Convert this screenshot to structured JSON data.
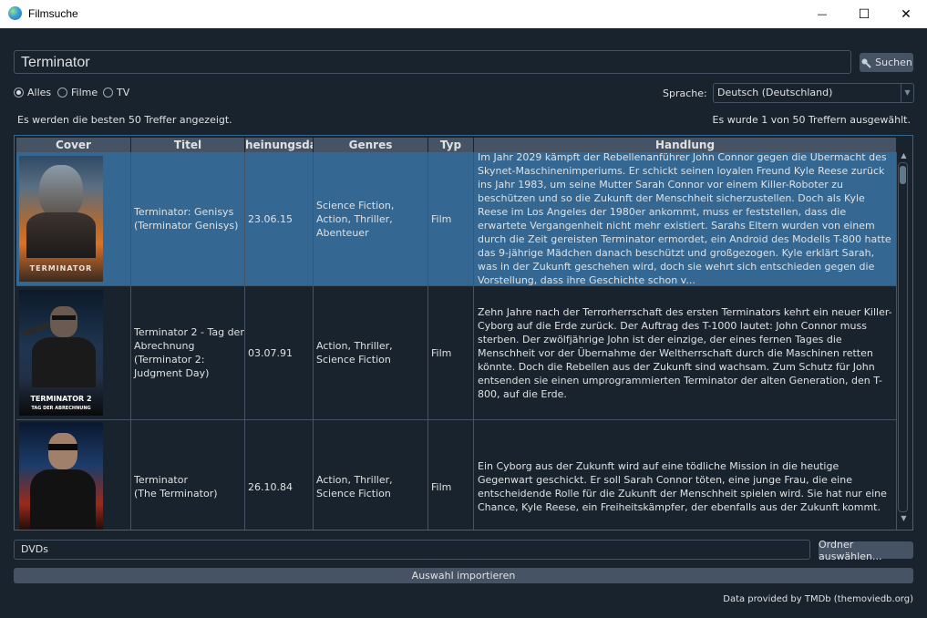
{
  "window": {
    "title": "Filmsuche",
    "minimize": "—",
    "maximize": "☐",
    "close": "✕"
  },
  "search": {
    "query": "Terminator",
    "button_label": "Suchen",
    "icon": "search-icon"
  },
  "filters": {
    "options": [
      "Alles",
      "Filme",
      "TV"
    ],
    "selected": "Alles"
  },
  "language": {
    "label": "Sprache:",
    "value": "Deutsch (Deutschland)"
  },
  "status": {
    "left": "Es werden die besten 50 Treffer angezeigt.",
    "right": "Es wurde 1 von 50 Treffern ausgewählt."
  },
  "table": {
    "columns": [
      "Cover",
      "Titel",
      "Erscheinungsdatum",
      "Genres",
      "Typ",
      "Handlung"
    ],
    "visible_header": "heinungsda",
    "rows": [
      {
        "selected": true,
        "titel": "Terminator: Genisys\n(Terminator Genisys)",
        "datum": "23.06.15",
        "genres": "Science Fiction,\nAction, Thriller,\nAbenteuer",
        "typ": "Film",
        "handlung": "Im Jahr 2029 kämpft der Rebellenanführer John Connor gegen die Übermacht des Skynet-Maschinenimperiums. Er schickt seinen loyalen Freund Kyle Reese zurück ins Jahr 1983, um seine Mutter Sarah Connor vor einem Killer-Roboter zu beschützen und so die Zukunft der Menschheit sicherzustellen. Doch als Kyle Reese im Los Angeles der 1980er ankommt, muss er feststellen, dass die erwartete Vergangenheit nicht mehr existiert. Sarahs Eltern wurden von einem durch die Zeit gereisten Terminator ermordet, ein Android des Modells T-800 hatte das 9-jährige Mädchen danach beschützt und großgezogen. Kyle erklärt Sarah, was in der Zukunft geschehen wird, doch sie wehrt sich entschieden gegen die Vorstellung, dass ihre Geschichte schon v...",
        "poster_text": "TERMINATOR"
      },
      {
        "selected": false,
        "titel": "Terminator 2 - Tag der Abrechnung\n(Terminator 2: Judgment Day)",
        "datum": "03.07.91",
        "genres": "Action, Thriller,\nScience Fiction",
        "typ": "Film",
        "handlung": "Zehn Jahre nach der Terrorherrschaft des ersten Terminators kehrt ein neuer Killer-Cyborg auf die Erde zurück. Der Auftrag des T-1000 lautet: John Connor muss sterben. Der zwölfjährige John ist der einzige, der eines fernen Tages die Menschheit vor der Übernahme der Weltherrschaft durch die Maschinen retten könnte. Doch die Rebellen aus der Zukunft sind wachsam. Zum Schutz für John entsenden sie einen umprogrammierten Terminator der alten Generation, den T-800, auf die Erde.",
        "poster_text": "TERMINATOR 2",
        "poster_subtext": "TAG DER ABRECHNUNG"
      },
      {
        "selected": false,
        "titel": "Terminator\n(The Terminator)",
        "datum": "26.10.84",
        "genres": "Action, Thriller,\nScience Fiction",
        "typ": "Film",
        "handlung": "Ein Cyborg aus der Zukunft wird auf eine tödliche Mission in die heutige Gegenwart geschickt. Er soll Sarah Connor töten, eine junge Frau, die eine entscheidende Rolle für die Zukunft der Menschheit spielen wird. Sie hat nur eine Chance, Kyle Reese, ein Freiheitskämpfer, der ebenfalls aus der Zukunft kommt."
      }
    ]
  },
  "folder": {
    "value": "DVDs",
    "button_label": "Ordner auswählen..."
  },
  "import_button": "Auswahl importieren",
  "credit": "Data provided by TMDb (themoviedb.org)",
  "colors": {
    "background": "#19232d",
    "selection": "#346792",
    "header": "#455364",
    "text": "#dfe1e2"
  }
}
